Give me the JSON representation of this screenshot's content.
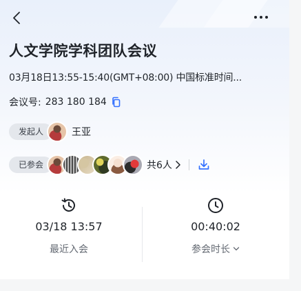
{
  "header": {
    "back_icon": "chevron-left-icon",
    "more_icon": "more-horizontal-icon"
  },
  "meeting": {
    "title": "人文学院学科团队会议",
    "time": "03月18日13:55-15:40(GMT+08:00) 中国标准时间...",
    "id_label": "会议号:",
    "id_value": "283 180 184",
    "copy_icon": "copy-icon"
  },
  "host": {
    "tag": "发起人",
    "name": "王亚",
    "avatar_icon": "avatar-photo"
  },
  "attendees": {
    "tag": "已参会",
    "count": "共6人",
    "avatar_count": 6,
    "download_icon": "download-icon"
  },
  "stats": {
    "recent_join": {
      "value": "03/18 13:57",
      "label": "最近入会",
      "icon": "history-clock-icon"
    },
    "duration": {
      "value": "00:40:02",
      "label": "参会时长",
      "icon": "clock-icon"
    }
  },
  "colors": {
    "accent": "#3370ff",
    "text": "#1f2329",
    "secondary": "#646a73",
    "tag_bg": "#e4e7ec"
  }
}
